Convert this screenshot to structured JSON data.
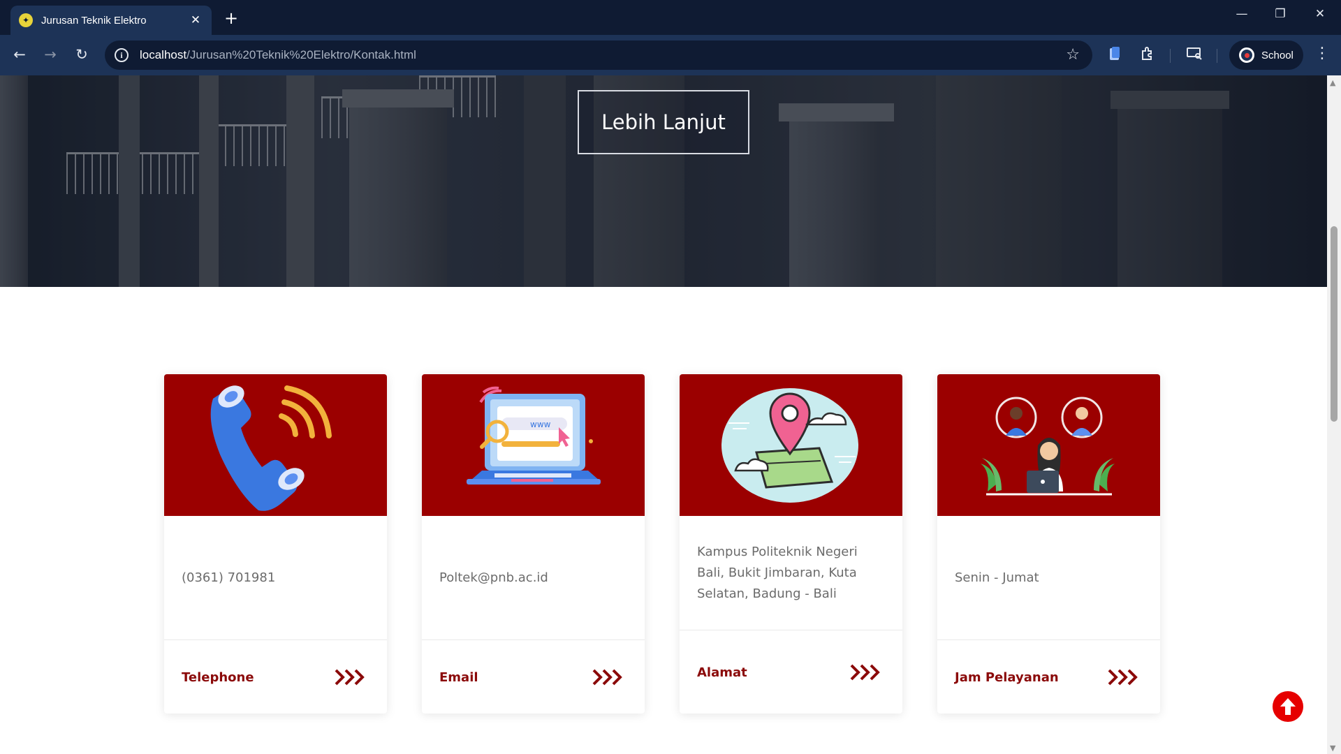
{
  "browser": {
    "tab_title": "Jurusan Teknik Elektro",
    "tab_close": "✕",
    "new_tab": "+",
    "url_host": "localhost",
    "url_path": "/Jurusan%20Teknik%20Elektro/Kontak.html",
    "profile_name": "School",
    "window_controls": {
      "minimize": "—",
      "restore": "❐",
      "close": "✕"
    },
    "nav": {
      "back": "←",
      "forward": "→",
      "reload": "↻"
    },
    "icons": [
      "info-icon",
      "star-icon",
      "clipboard-icon",
      "extensions-icon",
      "cast-icon",
      "menu-icon"
    ]
  },
  "hero": {
    "button_label": "Lebih Lanjut"
  },
  "cards": [
    {
      "text": "(0361) 701981",
      "label": "Telephone",
      "icon": "phone-icon"
    },
    {
      "text": "Poltek@pnb.ac.id",
      "label": "Email",
      "icon": "laptop-web-icon"
    },
    {
      "text": "Kampus Politeknik Negeri Bali, Bukit Jimbaran, Kuta Selatan, Badung - Bali",
      "label": "Alamat",
      "icon": "map-pin-icon"
    },
    {
      "text": "Senin - Jumat",
      "label": "Jam Pelayanan",
      "icon": "customer-service-icon"
    }
  ],
  "colors": {
    "card_header": "#9b0000",
    "card_label": "#8b0a0a",
    "back_to_top": "#e60000",
    "browser_frame": "#1d3357"
  }
}
